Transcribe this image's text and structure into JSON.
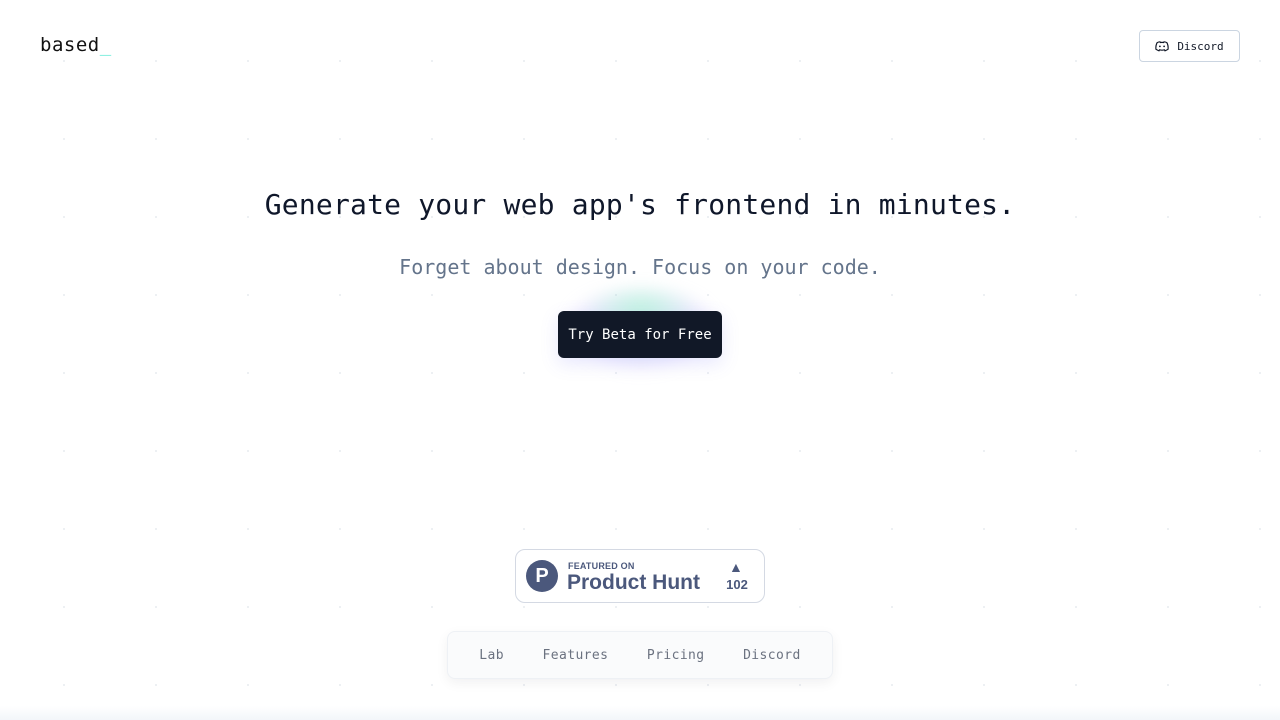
{
  "header": {
    "logo_text": "based",
    "logo_cursor": "_",
    "discord_label": "Discord",
    "discord_icon": "discord-icon"
  },
  "hero": {
    "title": "Generate your web app's frontend in minutes.",
    "subtitle": "Forget about design. Focus on your code.",
    "cta_label": "Try Beta for Free"
  },
  "product_hunt": {
    "logo_letter": "P",
    "featured_on": "FEATURED ON",
    "name": "Product Hunt",
    "upvote_icon": "triangle-up-icon",
    "upvote_arrow": "▲",
    "votes": "102"
  },
  "footer_nav": {
    "items": [
      {
        "label": "Lab"
      },
      {
        "label": "Features"
      },
      {
        "label": "Pricing"
      },
      {
        "label": "Discord"
      }
    ]
  },
  "colors": {
    "background": "#ffffff",
    "cta_background": "#111827",
    "cursor_accent": "#5eead4",
    "subtitle_text": "#64748b",
    "product_hunt": "#4b587c"
  }
}
